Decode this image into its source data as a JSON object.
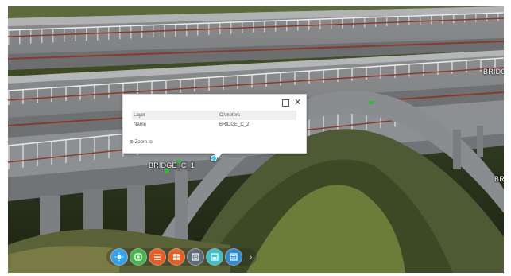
{
  "scene": {
    "labels": [
      "BRIDGE_C_1",
      "BRIDGE",
      "BRI"
    ]
  },
  "popup": {
    "rows": [
      {
        "key": "Layer",
        "value": "C:\\meters"
      },
      {
        "key": "Name",
        "value": "BRIDGE_C_2"
      }
    ],
    "zoom_to_label": "Zoom to"
  },
  "dock": {
    "buttons": [
      {
        "icon": "sun-icon",
        "color": "#2ea3f2"
      },
      {
        "icon": "layers-icon",
        "color": "#45b649"
      },
      {
        "icon": "list-icon",
        "color": "#f05a1e"
      },
      {
        "icon": "grid-icon",
        "color": "#ffffff"
      },
      {
        "icon": "slides-icon",
        "color": "#5c6b7a"
      },
      {
        "icon": "map-icon",
        "color": "#3ac4c9"
      },
      {
        "icon": "slides-2-icon",
        "color": "#2a8cd8"
      }
    ],
    "more_label": "›"
  }
}
